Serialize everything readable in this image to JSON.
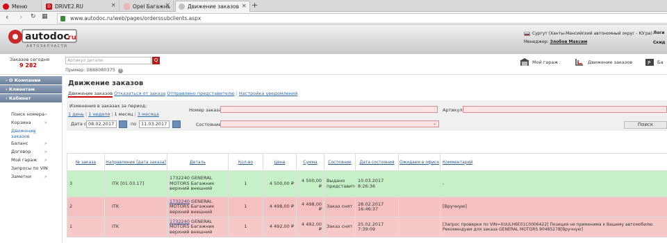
{
  "browser": {
    "tabs": [
      {
        "label": "Меню",
        "icon": "opera-icon"
      },
      {
        "label": "DRIVE2.RU",
        "icon": "drive2-icon"
      },
      {
        "label": "Opel Багажные дуги из а",
        "icon": "opel-icon"
      },
      {
        "label": "Движение заказов",
        "icon": "autodoc-icon"
      }
    ],
    "url": "www.autodoc.ru/web/pages/orderssubclients.aspx"
  },
  "header": {
    "logo_text": "autodoc.ru",
    "logo_sub": "АВТОЗАПЧАСТИ",
    "region": "Сургут (Ханты-Мансийский автономный округ - Югра)",
    "manager_label": "Менеджер:",
    "manager_name": "Злобов Максим",
    "right1": "Логи",
    "right2": "Скид"
  },
  "subbar": {
    "orders_today_label": "Заказов сегодня",
    "orders_today_count": "9 282",
    "article_placeholder": "Артикул детали",
    "example": "Пример: 0888080375",
    "garage": "Мой гараж",
    "orders_flow": "Движение заказов",
    "balance": "Ба"
  },
  "sidebar": {
    "heads": [
      "О Компании",
      "Клиентам",
      "Кабинет"
    ],
    "items": [
      "Поиск номера",
      "Корзина",
      "Движение заказов",
      "Баланс",
      "Договор",
      "Мой гараж",
      "Запросы по VIN",
      "Заметки"
    ]
  },
  "main": {
    "title": "Движение заказов",
    "tab_current": "Движение заказов",
    "tab_cancel": "Отказаться от заказа",
    "tab_sent": "Отправлено представителю",
    "tab_notify": "Настройка уведомлений",
    "period_label": "Изменения в заказах за период:",
    "p_day": "1 день",
    "p_week": "1 неделя",
    "p_month": "1 месяц",
    "p_3months": "3 месяца",
    "date_from_label": "Дата с",
    "date_from": "08.02.2017",
    "date_to_label": "по",
    "date_to": "11.03.2017",
    "order_num_label": "Номер заказа",
    "article_label": "Артикул",
    "state_label": "Состояние",
    "find": "Поиск"
  },
  "table": {
    "headers": [
      "№ заказа",
      "Направление [дата заказа]",
      "Деталь",
      "Кол-во",
      "Цена",
      "Сумма",
      "Состояние",
      "Дата состояния",
      "Ожидаем в офисе",
      "Комментарий"
    ],
    "rows": [
      {
        "n": "3",
        "dir": "ITK [01.03.17]",
        "part_code": "1732240",
        "part_name": "GENERAL MOTORS Багажник верхний внешний",
        "qty": "1",
        "price": "4 500,00 ₽",
        "sum": "4 500,00 ₽",
        "state": "Выдано представителю",
        "date": "10.03.2017 8:26:36",
        "expect": "",
        "comment": "-"
      },
      {
        "n": "2",
        "dir": "ITK",
        "part_code": "1732240",
        "part_name": "GENERAL MOTORS Багажник верхний внешний",
        "qty": "1",
        "price": "4 498,00 ₽",
        "sum": "4 498,00 ₽",
        "state": "Заказ снят",
        "date": "28.02.2017 16:46:37",
        "expect": "",
        "comment": "[Вручную]"
      },
      {
        "n": "1",
        "dir": "ITK",
        "part_code": "1732240",
        "part_name": "GENERAL MOTORS Багажник верхний внешний",
        "qty": "1",
        "price": "4 492,00 ₽",
        "sum": "4 492,00 ₽",
        "state": "Заказ снят",
        "date": "25.02.2017 7:39:09",
        "expect": "",
        "comment": "[Запрос проверки по VIN=XUULH6E01C0006422] Позиция не применима к Вашему автомобилю. Рекомендуем для заказа GENERAL MOTORS 90485278[Вручную]"
      }
    ]
  }
}
